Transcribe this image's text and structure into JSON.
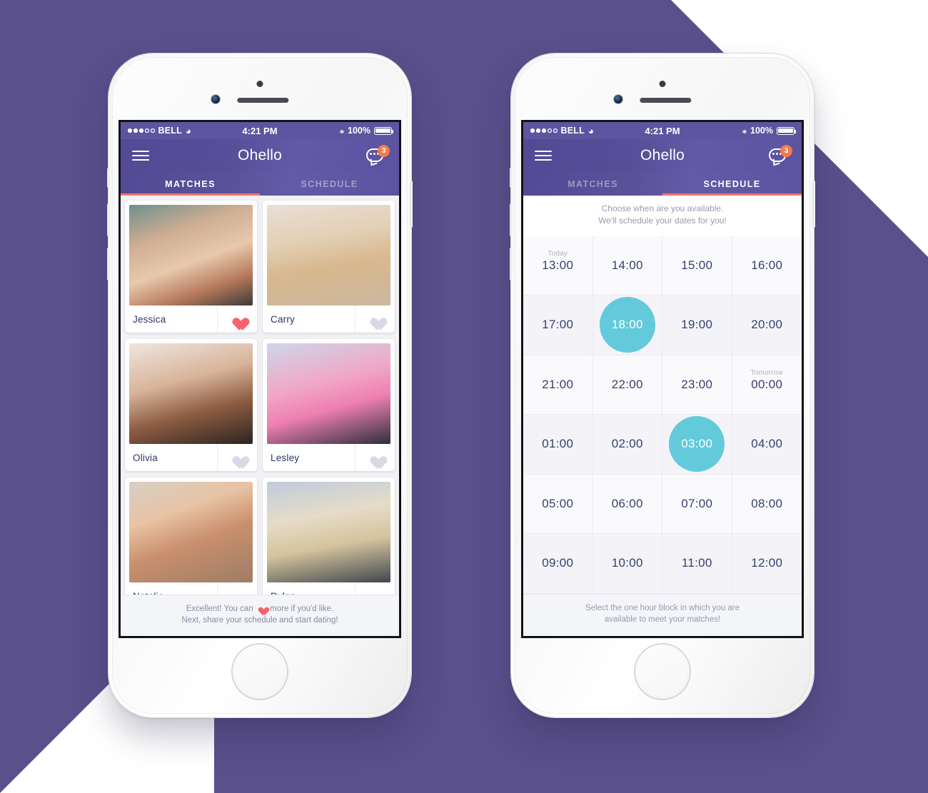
{
  "background": {
    "purple": "#59508c",
    "white": "#ffffff"
  },
  "status_bar": {
    "carrier": "BELL",
    "signal_filled": 3,
    "signal_empty": 2,
    "wifi_icon": "wifi-icon",
    "time": "4:21 PM",
    "bluetooth_icon": "bluetooth-icon",
    "battery_percent": "100%",
    "battery_level": 100
  },
  "header": {
    "menu_icon": "hamburger-icon",
    "title": "Ohello",
    "chat_icon": "chat-bubble-icon",
    "chat_badge": "3",
    "badge_color": "#f47b4a"
  },
  "tabs": {
    "matches_label": "MATCHES",
    "schedule_label": "SCHEDULE",
    "indicator_color": "#f4776b"
  },
  "phone_left": {
    "active_tab": "MATCHES",
    "matches": [
      {
        "name": "Jessica",
        "liked": true,
        "heart_icon": "heart-icon-filled"
      },
      {
        "name": "Carry",
        "liked": false,
        "heart_icon": "heart-icon-outline"
      },
      {
        "name": "Olivia",
        "liked": false,
        "heart_icon": "heart-icon-outline"
      },
      {
        "name": "Lesley",
        "liked": false,
        "heart_icon": "heart-icon-outline"
      },
      {
        "name": "Natalie",
        "liked": false,
        "heart_icon": "heart-icon-outline"
      },
      {
        "name": "Dylan",
        "liked": false,
        "heart_icon": "heart-icon-outline"
      }
    ],
    "footer_line1_before": "Excellent! You can",
    "footer_line1_after": "more if you'd like.",
    "footer_line2": "Next, share your schedule and start dating!",
    "liked_color": "#f9626c",
    "unliked_color": "#d9d9e6"
  },
  "phone_right": {
    "active_tab": "SCHEDULE",
    "hint_line1": "Choose when are you available.",
    "hint_line2": "We'll schedule your dates for you!",
    "selected_color": "#62cada",
    "slots": [
      {
        "time": "13:00",
        "day": "Today",
        "selected": false
      },
      {
        "time": "14:00",
        "day": "",
        "selected": false
      },
      {
        "time": "15:00",
        "day": "",
        "selected": false
      },
      {
        "time": "16:00",
        "day": "",
        "selected": false
      },
      {
        "time": "17:00",
        "day": "",
        "selected": false
      },
      {
        "time": "18:00",
        "day": "",
        "selected": true
      },
      {
        "time": "19:00",
        "day": "",
        "selected": false
      },
      {
        "time": "20:00",
        "day": "",
        "selected": false
      },
      {
        "time": "21:00",
        "day": "",
        "selected": false
      },
      {
        "time": "22:00",
        "day": "",
        "selected": false
      },
      {
        "time": "23:00",
        "day": "",
        "selected": false
      },
      {
        "time": "00:00",
        "day": "Tomorrow",
        "selected": false
      },
      {
        "time": "01:00",
        "day": "",
        "selected": false
      },
      {
        "time": "02:00",
        "day": "",
        "selected": false
      },
      {
        "time": "03:00",
        "day": "",
        "selected": true
      },
      {
        "time": "04:00",
        "day": "",
        "selected": false
      },
      {
        "time": "05:00",
        "day": "",
        "selected": false
      },
      {
        "time": "06:00",
        "day": "",
        "selected": false
      },
      {
        "time": "07:00",
        "day": "",
        "selected": false
      },
      {
        "time": "08:00",
        "day": "",
        "selected": false
      },
      {
        "time": "09:00",
        "day": "",
        "selected": false
      },
      {
        "time": "10:00",
        "day": "",
        "selected": false
      },
      {
        "time": "11:00",
        "day": "",
        "selected": false
      },
      {
        "time": "12:00",
        "day": "",
        "selected": false
      }
    ],
    "footer_line1": "Select the one hour block in which you are",
    "footer_line2": "available to meet your matches!"
  }
}
